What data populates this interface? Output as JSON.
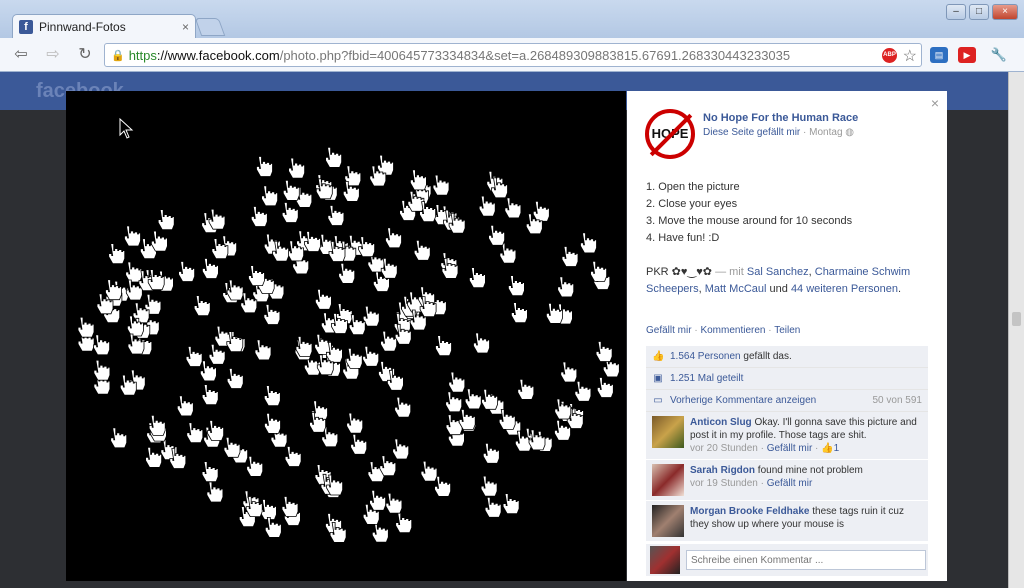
{
  "browser": {
    "tab_title": "Pinnwand-Fotos",
    "tab_close": "×",
    "url_protocol": "https",
    "url_host": "://www.facebook.com",
    "url_path": "/photo.php?fbid=400645773334834&set=a.268489309883815.67691.268330443233035",
    "nav_back": "⇦",
    "nav_forward": "⇨",
    "nav_reload": "↻",
    "win_minimize": "‒",
    "win_maximize": "□",
    "win_close": "×",
    "abp": "ABP",
    "star": "☆",
    "ext1": "▤",
    "ext2": "▶",
    "wrench": "🔧"
  },
  "background": {
    "fb_logo": "facebook"
  },
  "post": {
    "close": "×",
    "avatar_text": "HOPE",
    "page_name": "No Hope For the Human Race",
    "like_page": "Diese Seite gefällt mir",
    "dot": " · ",
    "time": "Montag",
    "steps": [
      "1. Open the picture",
      "2. Close your eyes",
      "3. Move the mouse around for 10 seconds",
      "4. Have fun! :D"
    ],
    "caption_prefix": "PKR ✿♥‿♥✿",
    "caption_with": " — mit ",
    "tag1": "Sal Sanchez",
    "sep": ", ",
    "tag2": "Charmaine Schwim Scheepers",
    "tag3": "Matt McCaul",
    "and": " und ",
    "tag_more": "44 weiteren Personen",
    "period": ".",
    "action_like": "Gefällt mir",
    "action_comment": "Kommentieren",
    "action_share": "Teilen",
    "likes_link": "1.564 Personen",
    "likes_suffix": " gefällt das.",
    "shares": "1.251 Mal geteilt",
    "prev_comments": "Vorherige Kommentare anzeigen",
    "comment_count": "50 von 591",
    "comments": [
      {
        "author": "Anticon Slug",
        "text": "Okay. I'll gonna save this picture and post it in my profile. Those tags are shit.",
        "time": "vor 20 Stunden",
        "like": "Gefällt mir",
        "likes": "1"
      },
      {
        "author": "Sarah Rigdon",
        "text": "found mine not problem",
        "time": "vor 19 Stunden",
        "like": "Gefällt mir",
        "likes": ""
      },
      {
        "author": "Morgan Brooke Feldhake",
        "text": "these tags ruin it cuz they show up where your mouse is",
        "time": "",
        "like": "",
        "likes": ""
      }
    ],
    "write_placeholder": "Schreibe einen Kommentar ..."
  }
}
